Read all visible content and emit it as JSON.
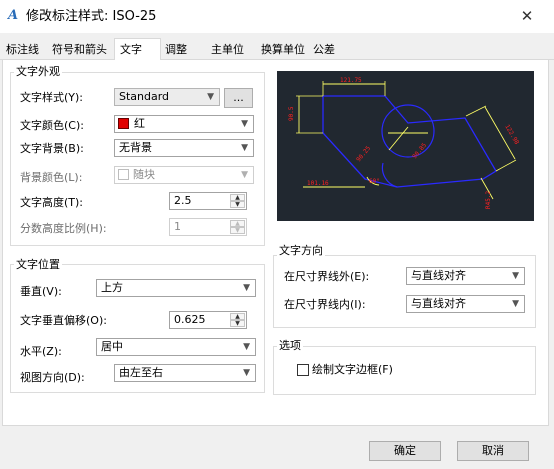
{
  "window": {
    "title": "修改标注样式: ISO-25",
    "app_icon": "autocad-icon",
    "close_glyph": "✕"
  },
  "tabs": [
    "标注线",
    "符号和箭头",
    "文字",
    "调整",
    "主单位",
    "换算单位",
    "公差"
  ],
  "text_appearance": {
    "group_title": "文字外观",
    "style_label": "文字样式(Y):",
    "style_value": "Standard",
    "style_browse_label": "...",
    "color_label": "文字颜色(C):",
    "color_value": "红",
    "color_hex": "#e00000",
    "fill_label": "文字背景(B):",
    "fill_value": "无背景",
    "bgcolor_label": "背景颜色(L):",
    "bgcolor_value": "随块",
    "height_label": "文字高度(T):",
    "height_value": "2.5",
    "fraction_label": "分数高度比例(H):",
    "fraction_value": "1"
  },
  "text_placement": {
    "group_title": "文字位置",
    "vertical_label": "垂直(V):",
    "vertical_value": "上方",
    "offset_label": "文字垂直偏移(O):",
    "offset_value": "0.625",
    "horizontal_label": "水平(Z):",
    "horizontal_value": "居中",
    "view_dir_label": "视图方向(D):",
    "view_dir_value": "由左至右"
  },
  "text_alignment": {
    "group_title": "文字方向",
    "outside_label": "在尺寸界线外(E):",
    "outside_value": "与直线对齐",
    "inside_label": "在尺寸界线内(I):",
    "inside_value": "与直线对齐"
  },
  "options": {
    "group_title": "选项",
    "frame_label": "绘制文字边框(F)",
    "frame_checked": false
  },
  "buttons": {
    "ok": "确定",
    "cancel": "取消"
  },
  "preview": {
    "labels": {
      "top": "121.75",
      "left": "90.5",
      "right": "122.98",
      "bottom": "101.16",
      "diag1": "90.25",
      "diag2": "90.85",
      "angle": "60°",
      "radius": "R45.2"
    },
    "colors": {
      "background": "#212830",
      "outline": "#2a2aff",
      "dimension": "#ffff66",
      "text": "#ff2020"
    }
  }
}
